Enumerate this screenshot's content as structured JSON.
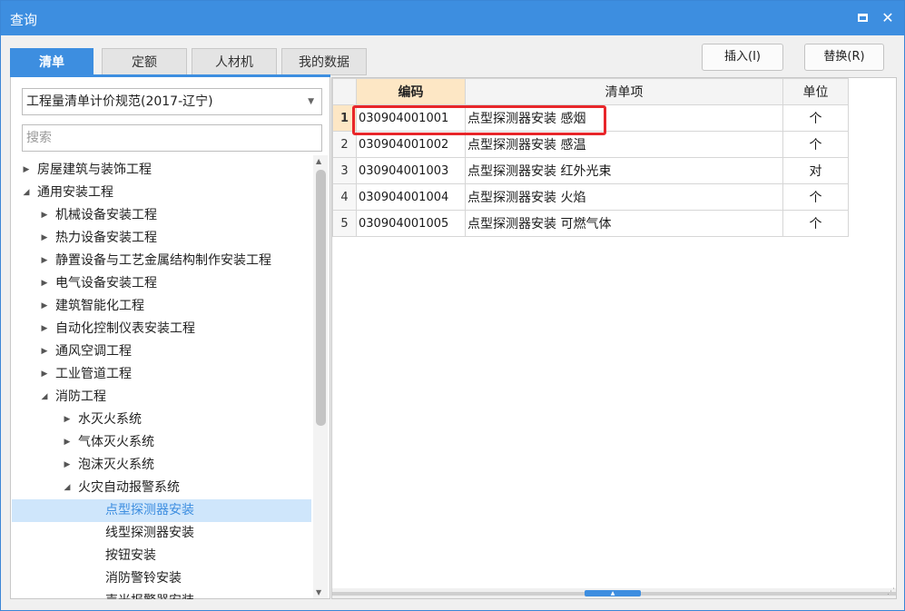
{
  "window": {
    "title": "查询",
    "maximize_icon": "maximize-icon",
    "close_icon": "close-icon",
    "close_glyph": "✕"
  },
  "tabs": [
    {
      "label": "清单",
      "active": true
    },
    {
      "label": "定额",
      "active": false
    },
    {
      "label": "人材机",
      "active": false
    },
    {
      "label": "我的数据",
      "active": false
    }
  ],
  "buttons": {
    "insert": "插入(I)",
    "replace": "替换(R)"
  },
  "left": {
    "spec_select": "工程量清单计价规范(2017-辽宁)",
    "search_placeholder": "搜索"
  },
  "tree": [
    {
      "label": "房屋建筑与装饰工程",
      "level": 0,
      "expanded": false
    },
    {
      "label": "通用安装工程",
      "level": 0,
      "expanded": true
    },
    {
      "label": "机械设备安装工程",
      "level": 1,
      "expanded": false
    },
    {
      "label": "热力设备安装工程",
      "level": 1,
      "expanded": false
    },
    {
      "label": "静置设备与工艺金属结构制作安装工程",
      "level": 1,
      "expanded": false
    },
    {
      "label": "电气设备安装工程",
      "level": 1,
      "expanded": false
    },
    {
      "label": "建筑智能化工程",
      "level": 1,
      "expanded": false
    },
    {
      "label": "自动化控制仪表安装工程",
      "level": 1,
      "expanded": false
    },
    {
      "label": "通风空调工程",
      "level": 1,
      "expanded": false
    },
    {
      "label": "工业管道工程",
      "level": 1,
      "expanded": false
    },
    {
      "label": "消防工程",
      "level": 1,
      "expanded": true
    },
    {
      "label": "水灭火系统",
      "level": 2,
      "expanded": false
    },
    {
      "label": "气体灭火系统",
      "level": 2,
      "expanded": false
    },
    {
      "label": "泡沫灭火系统",
      "level": 2,
      "expanded": false
    },
    {
      "label": "火灾自动报警系统",
      "level": 2,
      "expanded": true
    },
    {
      "label": "点型探测器安装",
      "level": 3,
      "selected": true
    },
    {
      "label": "线型探测器安装",
      "level": 3
    },
    {
      "label": "按钮安装",
      "level": 3
    },
    {
      "label": "消防警铃安装",
      "level": 3
    },
    {
      "label": "声光报警器安装",
      "level": 3
    }
  ],
  "grid": {
    "columns": [
      "编码",
      "清单项",
      "单位"
    ],
    "rows": [
      {
        "n": "1",
        "code": "030904001001",
        "item": "点型探测器安装 感烟",
        "unit": "个"
      },
      {
        "n": "2",
        "code": "030904001002",
        "item": "点型探测器安装 感温",
        "unit": "个"
      },
      {
        "n": "3",
        "code": "030904001003",
        "item": "点型探测器安装 红外光束",
        "unit": "对"
      },
      {
        "n": "4",
        "code": "030904001004",
        "item": "点型探测器安装 火焰",
        "unit": "个"
      },
      {
        "n": "5",
        "code": "030904001005",
        "item": "点型探测器安装 可燃气体",
        "unit": "个"
      }
    ]
  },
  "colors": {
    "accent": "#3d8ee0",
    "highlight": "#e8262a",
    "header_active": "#fde7c5",
    "selected_row": "#cfe6fb"
  },
  "icons": {
    "collapsed": "triangle-right-icon",
    "expanded": "triangle-down-icon",
    "dropdown": "chevron-down-icon"
  }
}
